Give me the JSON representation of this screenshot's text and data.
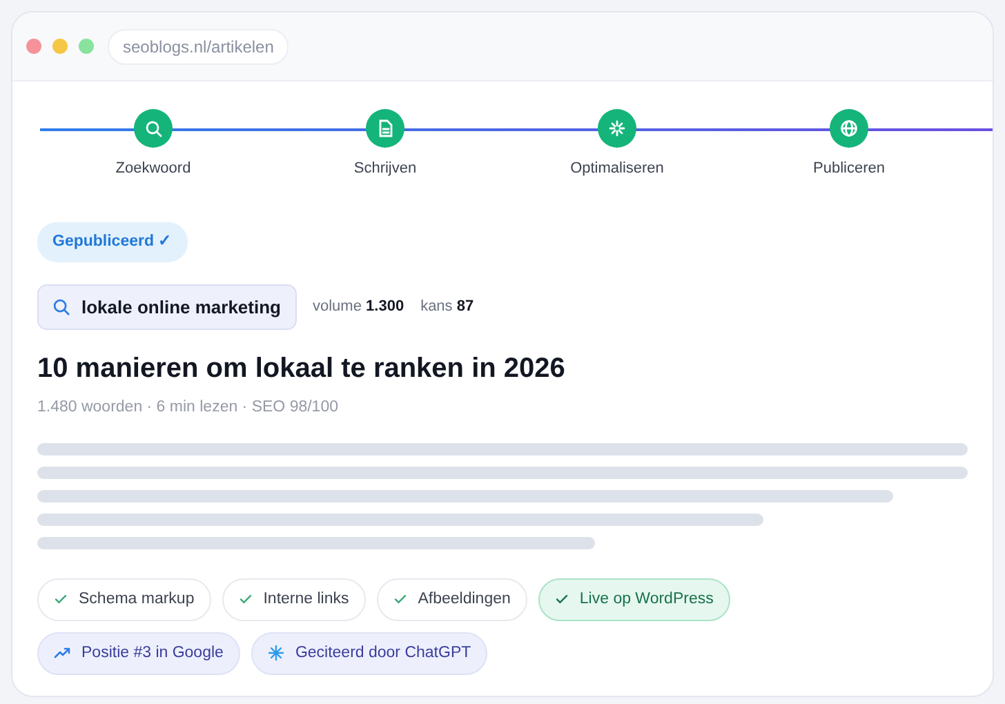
{
  "window": {
    "address": "seoblogs.nl/artikelen"
  },
  "steps": [
    {
      "label": "Zoekwoord",
      "kind": "search",
      "done": true
    },
    {
      "label": "Schrijven",
      "kind": "document",
      "done": true
    },
    {
      "label": "Optimaliseren",
      "kind": "sparkle",
      "done": true
    },
    {
      "label": "Publiceren",
      "kind": "globe",
      "done": true
    }
  ],
  "status_badge": "Gepubliceerd ✓",
  "keyword": {
    "text": "lokale online marketing",
    "stats": [
      {
        "label": "volume",
        "value": "1.300"
      },
      {
        "label": "kans",
        "value": "87"
      }
    ]
  },
  "article": {
    "title": "10 manieren om lokaal te ranken in 2026",
    "meta": "1.480 woorden · 6 min lezen · SEO 98/100"
  },
  "chips": [
    {
      "label": "Schema markup",
      "kind": "done"
    },
    {
      "label": "Interne links",
      "kind": "done"
    },
    {
      "label": "Afbeeldingen",
      "kind": "done"
    },
    {
      "label": "Live op WordPress",
      "kind": "live"
    }
  ],
  "results": [
    {
      "label": "Positie #3 in Google",
      "kind": "rank"
    },
    {
      "label": "Geciteerd door ChatGPT",
      "kind": "ai"
    }
  ]
}
